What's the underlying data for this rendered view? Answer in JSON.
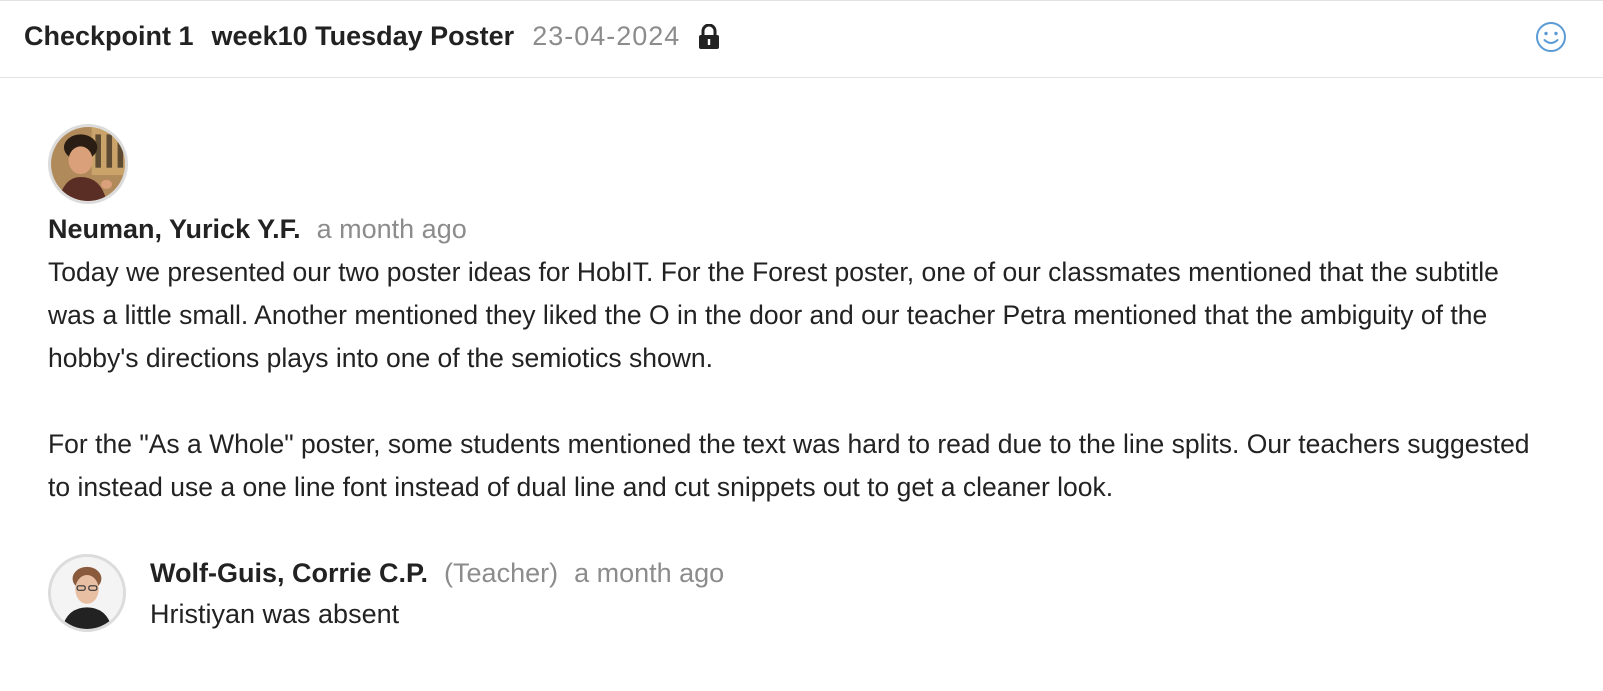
{
  "header": {
    "checkpoint": "Checkpoint 1",
    "poster_title": "week10 Tuesday Poster",
    "date": "23-04-2024",
    "lock_icon": "lock-icon",
    "feedback_icon": "smiley-icon",
    "accent_color": "#5b9bd5"
  },
  "post": {
    "author": "Neuman, Yurick Y.F.",
    "time": "a month ago",
    "paragraphs": [
      "Today we presented our two poster ideas for HobIT. For the Forest poster, one of our classmates mentioned that the subtitle was a little small. Another mentioned they liked the O in the door and our teacher Petra mentioned that the ambiguity of the hobby's directions plays into one of the semiotics shown.",
      "For the \"As a Whole\" poster, some students mentioned the text was hard to read due to the line splits. Our teachers suggested to instead use a one line font instead of dual line and cut snippets out to get a cleaner look."
    ]
  },
  "comment": {
    "author": "Wolf-Guis, Corrie C.P.",
    "role": "(Teacher)",
    "time": "a month ago",
    "text": "Hristiyan was absent"
  }
}
